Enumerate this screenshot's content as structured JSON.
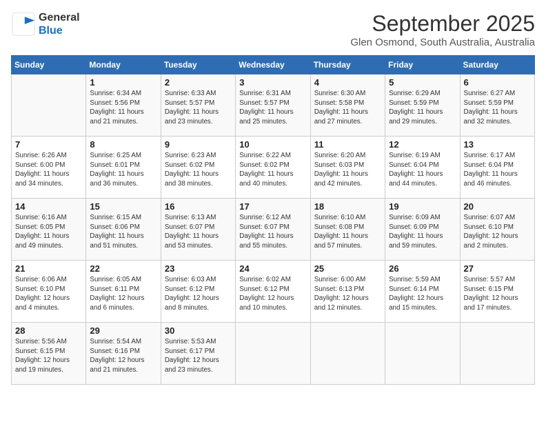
{
  "header": {
    "logo_line1": "General",
    "logo_line2": "Blue",
    "month": "September 2025",
    "location": "Glen Osmond, South Australia, Australia"
  },
  "weekdays": [
    "Sunday",
    "Monday",
    "Tuesday",
    "Wednesday",
    "Thursday",
    "Friday",
    "Saturday"
  ],
  "weeks": [
    [
      {
        "day": "",
        "info": ""
      },
      {
        "day": "1",
        "info": "Sunrise: 6:34 AM\nSunset: 5:56 PM\nDaylight: 11 hours\nand 21 minutes."
      },
      {
        "day": "2",
        "info": "Sunrise: 6:33 AM\nSunset: 5:57 PM\nDaylight: 11 hours\nand 23 minutes."
      },
      {
        "day": "3",
        "info": "Sunrise: 6:31 AM\nSunset: 5:57 PM\nDaylight: 11 hours\nand 25 minutes."
      },
      {
        "day": "4",
        "info": "Sunrise: 6:30 AM\nSunset: 5:58 PM\nDaylight: 11 hours\nand 27 minutes."
      },
      {
        "day": "5",
        "info": "Sunrise: 6:29 AM\nSunset: 5:59 PM\nDaylight: 11 hours\nand 29 minutes."
      },
      {
        "day": "6",
        "info": "Sunrise: 6:27 AM\nSunset: 5:59 PM\nDaylight: 11 hours\nand 32 minutes."
      }
    ],
    [
      {
        "day": "7",
        "info": "Sunrise: 6:26 AM\nSunset: 6:00 PM\nDaylight: 11 hours\nand 34 minutes."
      },
      {
        "day": "8",
        "info": "Sunrise: 6:25 AM\nSunset: 6:01 PM\nDaylight: 11 hours\nand 36 minutes."
      },
      {
        "day": "9",
        "info": "Sunrise: 6:23 AM\nSunset: 6:02 PM\nDaylight: 11 hours\nand 38 minutes."
      },
      {
        "day": "10",
        "info": "Sunrise: 6:22 AM\nSunset: 6:02 PM\nDaylight: 11 hours\nand 40 minutes."
      },
      {
        "day": "11",
        "info": "Sunrise: 6:20 AM\nSunset: 6:03 PM\nDaylight: 11 hours\nand 42 minutes."
      },
      {
        "day": "12",
        "info": "Sunrise: 6:19 AM\nSunset: 6:04 PM\nDaylight: 11 hours\nand 44 minutes."
      },
      {
        "day": "13",
        "info": "Sunrise: 6:17 AM\nSunset: 6:04 PM\nDaylight: 11 hours\nand 46 minutes."
      }
    ],
    [
      {
        "day": "14",
        "info": "Sunrise: 6:16 AM\nSunset: 6:05 PM\nDaylight: 11 hours\nand 49 minutes."
      },
      {
        "day": "15",
        "info": "Sunrise: 6:15 AM\nSunset: 6:06 PM\nDaylight: 11 hours\nand 51 minutes."
      },
      {
        "day": "16",
        "info": "Sunrise: 6:13 AM\nSunset: 6:07 PM\nDaylight: 11 hours\nand 53 minutes."
      },
      {
        "day": "17",
        "info": "Sunrise: 6:12 AM\nSunset: 6:07 PM\nDaylight: 11 hours\nand 55 minutes."
      },
      {
        "day": "18",
        "info": "Sunrise: 6:10 AM\nSunset: 6:08 PM\nDaylight: 11 hours\nand 57 minutes."
      },
      {
        "day": "19",
        "info": "Sunrise: 6:09 AM\nSunset: 6:09 PM\nDaylight: 11 hours\nand 59 minutes."
      },
      {
        "day": "20",
        "info": "Sunrise: 6:07 AM\nSunset: 6:10 PM\nDaylight: 12 hours\nand 2 minutes."
      }
    ],
    [
      {
        "day": "21",
        "info": "Sunrise: 6:06 AM\nSunset: 6:10 PM\nDaylight: 12 hours\nand 4 minutes."
      },
      {
        "day": "22",
        "info": "Sunrise: 6:05 AM\nSunset: 6:11 PM\nDaylight: 12 hours\nand 6 minutes."
      },
      {
        "day": "23",
        "info": "Sunrise: 6:03 AM\nSunset: 6:12 PM\nDaylight: 12 hours\nand 8 minutes."
      },
      {
        "day": "24",
        "info": "Sunrise: 6:02 AM\nSunset: 6:12 PM\nDaylight: 12 hours\nand 10 minutes."
      },
      {
        "day": "25",
        "info": "Sunrise: 6:00 AM\nSunset: 6:13 PM\nDaylight: 12 hours\nand 12 minutes."
      },
      {
        "day": "26",
        "info": "Sunrise: 5:59 AM\nSunset: 6:14 PM\nDaylight: 12 hours\nand 15 minutes."
      },
      {
        "day": "27",
        "info": "Sunrise: 5:57 AM\nSunset: 6:15 PM\nDaylight: 12 hours\nand 17 minutes."
      }
    ],
    [
      {
        "day": "28",
        "info": "Sunrise: 5:56 AM\nSunset: 6:15 PM\nDaylight: 12 hours\nand 19 minutes."
      },
      {
        "day": "29",
        "info": "Sunrise: 5:54 AM\nSunset: 6:16 PM\nDaylight: 12 hours\nand 21 minutes."
      },
      {
        "day": "30",
        "info": "Sunrise: 5:53 AM\nSunset: 6:17 PM\nDaylight: 12 hours\nand 23 minutes."
      },
      {
        "day": "",
        "info": ""
      },
      {
        "day": "",
        "info": ""
      },
      {
        "day": "",
        "info": ""
      },
      {
        "day": "",
        "info": ""
      }
    ]
  ]
}
